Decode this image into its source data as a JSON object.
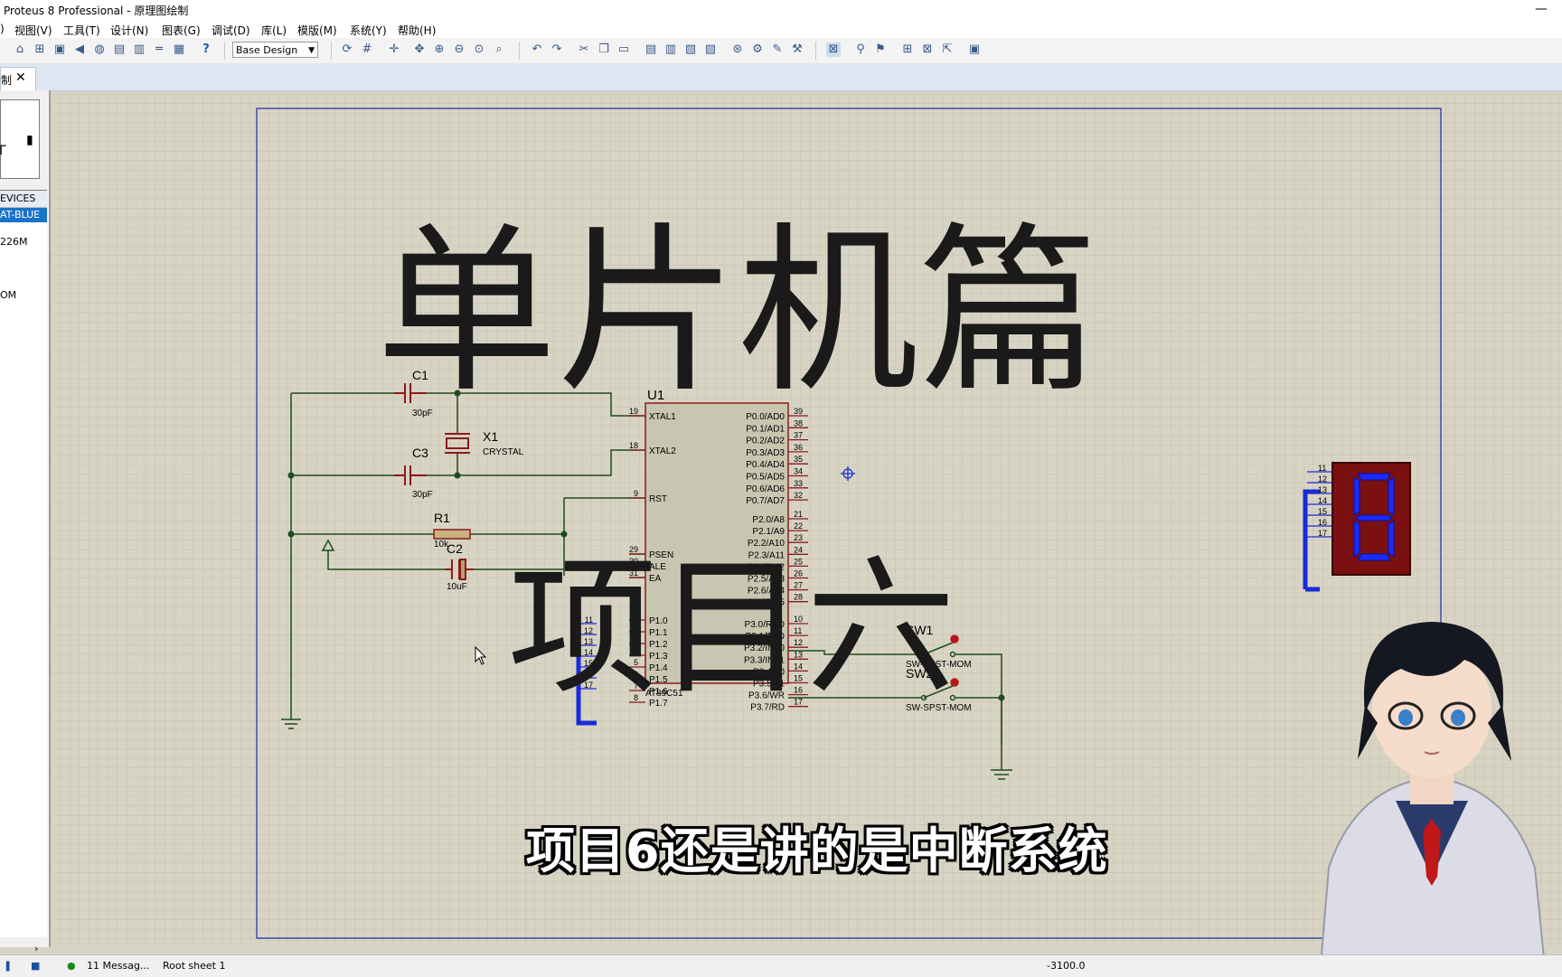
{
  "window": {
    "title": "Proteus 8 Professional - 原理图绘制"
  },
  "menu": [
    "视图(V)",
    "工具(T)",
    "设计(N)",
    "图表(G)",
    "调试(D)",
    "库(L)",
    "模版(M)",
    "系统(Y)",
    "帮助(H)"
  ],
  "toolbar": {
    "design_select": "Base Design"
  },
  "tab": {
    "label": "制"
  },
  "left_panel": {
    "devices_header": "EVICES",
    "devices": [
      "AT-BLUE",
      "226M",
      "OM"
    ]
  },
  "schematic": {
    "overlay_title": "单片机篇",
    "overlay_subtitle": "项目六",
    "u1": {
      "ref": "U1",
      "part": "AT89C51",
      "left_pins": [
        {
          "num": "19",
          "name": "XTAL1"
        },
        {
          "num": "18",
          "name": "XTAL2"
        },
        {
          "num": "9",
          "name": "RST"
        },
        {
          "num": "29",
          "name": "PSEN"
        },
        {
          "num": "30",
          "name": "ALE"
        },
        {
          "num": "31",
          "name": "EA"
        },
        {
          "num": "1",
          "name": "P1.0"
        },
        {
          "num": "2",
          "name": "P1.1"
        },
        {
          "num": "3",
          "name": "P1.2"
        },
        {
          "num": "4",
          "name": "P1.3"
        },
        {
          "num": "5",
          "name": "P1.4"
        },
        {
          "num": "6",
          "name": "P1.5"
        },
        {
          "num": "7",
          "name": "P1.6"
        },
        {
          "num": "8",
          "name": "P1.7"
        }
      ],
      "right_pins": [
        {
          "num": "39",
          "name": "P0.0/AD0"
        },
        {
          "num": "38",
          "name": "P0.1/AD1"
        },
        {
          "num": "37",
          "name": "P0.2/AD2"
        },
        {
          "num": "36",
          "name": "P0.3/AD3"
        },
        {
          "num": "35",
          "name": "P0.4/AD4"
        },
        {
          "num": "34",
          "name": "P0.5/AD5"
        },
        {
          "num": "33",
          "name": "P0.6/AD6"
        },
        {
          "num": "32",
          "name": "P0.7/AD7"
        },
        {
          "num": "21",
          "name": "P2.0/A8"
        },
        {
          "num": "22",
          "name": "P2.1/A9"
        },
        {
          "num": "23",
          "name": "P2.2/A10"
        },
        {
          "num": "24",
          "name": "P2.3/A11"
        },
        {
          "num": "25",
          "name": "P2.4/A12"
        },
        {
          "num": "26",
          "name": "P2.5/A13"
        },
        {
          "num": "27",
          "name": "P2.6/A14"
        },
        {
          "num": "28",
          "name": "P2.7/A15"
        },
        {
          "num": "10",
          "name": "P3.0/RXD"
        },
        {
          "num": "11",
          "name": "P3.1/TXD"
        },
        {
          "num": "12",
          "name": "P3.2/INT0"
        },
        {
          "num": "13",
          "name": "P3.3/INT1"
        },
        {
          "num": "14",
          "name": "P3.4/T0"
        },
        {
          "num": "15",
          "name": "P3.5/T1"
        },
        {
          "num": "16",
          "name": "P3.6/WR"
        },
        {
          "num": "17",
          "name": "P3.7/RD"
        }
      ]
    },
    "c1": {
      "ref": "C1",
      "value": "30pF"
    },
    "c3": {
      "ref": "C3",
      "value": "30pF"
    },
    "x1": {
      "ref": "X1",
      "value": "CRYSTAL"
    },
    "r1": {
      "ref": "R1",
      "value": "10k"
    },
    "c2": {
      "ref": "C2",
      "value": "10uF"
    },
    "sw1": {
      "ref": "SW1",
      "part": "SW-SPST-MOM"
    },
    "sw2": {
      "ref": "SW2",
      "part": "SW-SPST-MOM"
    },
    "bus_left_labels": [
      "11",
      "12",
      "13",
      "14",
      "15",
      "16",
      "17"
    ],
    "bus_right_labels": [
      "11",
      "12",
      "13",
      "14",
      "15",
      "16",
      "17"
    ],
    "display_digit": "8"
  },
  "caption": "项目6还是讲的是中断系统",
  "status": {
    "messages": "11 Messag...",
    "sheet": "Root sheet 1",
    "coord": "-3100.0"
  },
  "colors": {
    "grid_bg": "#d8d4c4",
    "grid_line": "#c6c1b0",
    "wire": "#1e4d1e",
    "part": "#8b1a1a",
    "chip_fill": "#c8c6b0",
    "bus": "#1a2bd6",
    "border": "#00008b",
    "seg_on": "#1a2bff",
    "seg_bg": "#7a1010"
  }
}
